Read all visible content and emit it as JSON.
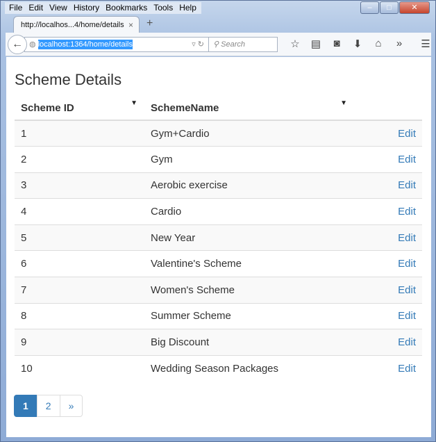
{
  "menu": [
    "File",
    "Edit",
    "View",
    "History",
    "Bookmarks",
    "Tools",
    "Help"
  ],
  "tab": {
    "title": "http://localhos...4/home/details",
    "close": "×",
    "new": "+"
  },
  "nav": {
    "url": "localhost:1364/home/details",
    "search_placeholder": "Search"
  },
  "page": {
    "title": "Scheme Details",
    "columns": [
      "Scheme ID",
      "SchemeName"
    ],
    "rows": [
      {
        "id": "1",
        "name": "Gym+Cardio",
        "action": "Edit"
      },
      {
        "id": "2",
        "name": "Gym",
        "action": "Edit"
      },
      {
        "id": "3",
        "name": "Aerobic exercise",
        "action": "Edit"
      },
      {
        "id": "4",
        "name": "Cardio",
        "action": "Edit"
      },
      {
        "id": "5",
        "name": "New Year",
        "action": "Edit"
      },
      {
        "id": "6",
        "name": "Valentine's Scheme",
        "action": "Edit"
      },
      {
        "id": "7",
        "name": "Women's Scheme",
        "action": "Edit"
      },
      {
        "id": "8",
        "name": "Summer Scheme",
        "action": "Edit"
      },
      {
        "id": "9",
        "name": "Big Discount",
        "action": "Edit"
      },
      {
        "id": "10",
        "name": "Wedding Season Packages",
        "action": "Edit"
      }
    ],
    "pager": [
      "1",
      "2",
      "»"
    ]
  },
  "colors": {
    "accent": "#337ab7"
  }
}
